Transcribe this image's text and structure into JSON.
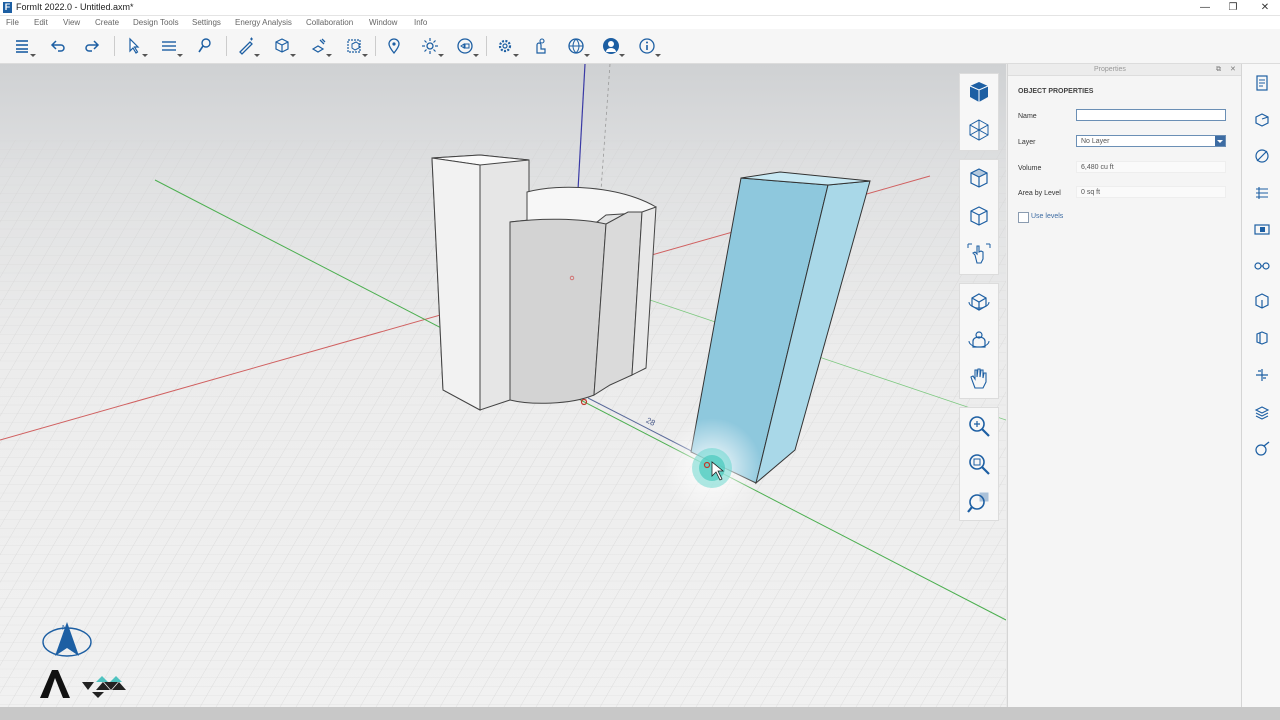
{
  "window": {
    "title": "FormIt 2022.0 - Untitled.axm*",
    "minimize": "—",
    "restore": "❐",
    "close": "✕"
  },
  "menu": [
    "File",
    "Edit",
    "View",
    "Create",
    "Design Tools",
    "Settings",
    "Energy Analysis",
    "Collaboration",
    "Window",
    "Info"
  ],
  "toolbar": {
    "tools": [
      "menu-icon",
      "undo-icon",
      "redo-icon",
      "select-icon",
      "measure-icon",
      "paint-icon",
      "sketch-icon",
      "cube-icon",
      "modify-icon",
      "group-icon",
      "location-icon",
      "sun-icon",
      "scene-view-icon",
      "settings-icon",
      "collaborate-icon",
      "globe-icon",
      "account-icon",
      "info-icon"
    ]
  },
  "viewport": {
    "dimension_label": "28"
  },
  "navigation": {
    "top": [
      "view-cube-icon",
      "axonometric-icon"
    ],
    "middle": [
      "orbit-cube-icon",
      "rotate-cube-icon",
      "pan-gesture-icon"
    ],
    "orbit": [
      "orbit-icon",
      "look-around-icon",
      "pan-hand-icon"
    ],
    "zoom": [
      "zoom-icon",
      "zoom-window-icon",
      "zoom-extents-icon"
    ]
  },
  "properties": {
    "panel_title": "Properties",
    "section_title": "OBJECT PROPERTIES",
    "name_label": "Name",
    "name_value": "",
    "layer_label": "Layer",
    "layer_value": "No Layer",
    "volume_label": "Volume",
    "volume_value": "6,480 cu ft",
    "area_label": "Area by Level",
    "area_value": "0 sq ft",
    "use_levels_label": "Use levels",
    "use_levels_checked": false
  },
  "right_panel_icons": [
    "properties-icon",
    "layers-icon",
    "materials-icon",
    "levels-icon",
    "scenes-icon",
    "visibility-icon",
    "components-icon",
    "groups-icon",
    "plugins-icon",
    "view-settings-icon",
    "style-icon"
  ],
  "colors": {
    "accent": "#1d5fa3",
    "selected_object": "#8cc6dc",
    "x_axis": "#c0392b",
    "y_axis": "#4caf50",
    "z_axis": "#3a3aa5"
  }
}
